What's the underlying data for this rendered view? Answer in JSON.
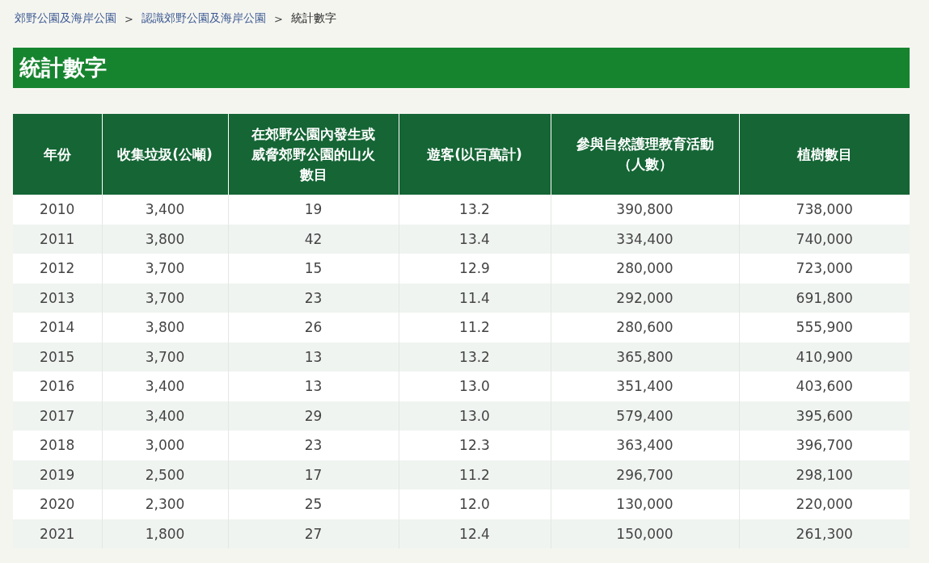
{
  "breadcrumb": [
    {
      "label": "郊野公園及海岸公園",
      "kind": "link"
    },
    {
      "label": "認識郊野公園及海岸公園",
      "kind": "link"
    },
    {
      "label": "統計數字",
      "kind": "current"
    }
  ],
  "breadcrumb_separator": ">",
  "title": "統計數字",
  "table": {
    "columns": [
      "年份",
      "收集垃圾(公噸)",
      "在郊野公園內發生或威脅郊野公園的山火數目",
      "遊客(以百萬計)",
      "參與自然護理教育活動（人數）",
      "植樹數目"
    ],
    "rows": [
      [
        "2010",
        "3,400",
        "19",
        "13.2",
        "390,800",
        "738,000"
      ],
      [
        "2011",
        "3,800",
        "42",
        "13.4",
        "334,400",
        "740,000"
      ],
      [
        "2012",
        "3,700",
        "15",
        "12.9",
        "280,000",
        "723,000"
      ],
      [
        "2013",
        "3,700",
        "23",
        "11.4",
        "292,000",
        "691,800"
      ],
      [
        "2014",
        "3,800",
        "26",
        "11.2",
        "280,600",
        "555,900"
      ],
      [
        "2015",
        "3,700",
        "13",
        "13.2",
        "365,800",
        "410,900"
      ],
      [
        "2016",
        "3,400",
        "13",
        "13.0",
        "351,400",
        "403,600"
      ],
      [
        "2017",
        "3,400",
        "29",
        "13.0",
        "579,400",
        "395,600"
      ],
      [
        "2018",
        "3,000",
        "23",
        "12.3",
        "363,400",
        "396,700"
      ],
      [
        "2019",
        "2,500",
        "17",
        "11.2",
        "296,700",
        "298,100"
      ],
      [
        "2020",
        "2,300",
        "25",
        "12.0",
        "130,000",
        "220,000"
      ],
      [
        "2021",
        "1,800",
        "27",
        "12.4",
        "150,000",
        "261,300"
      ]
    ]
  }
}
